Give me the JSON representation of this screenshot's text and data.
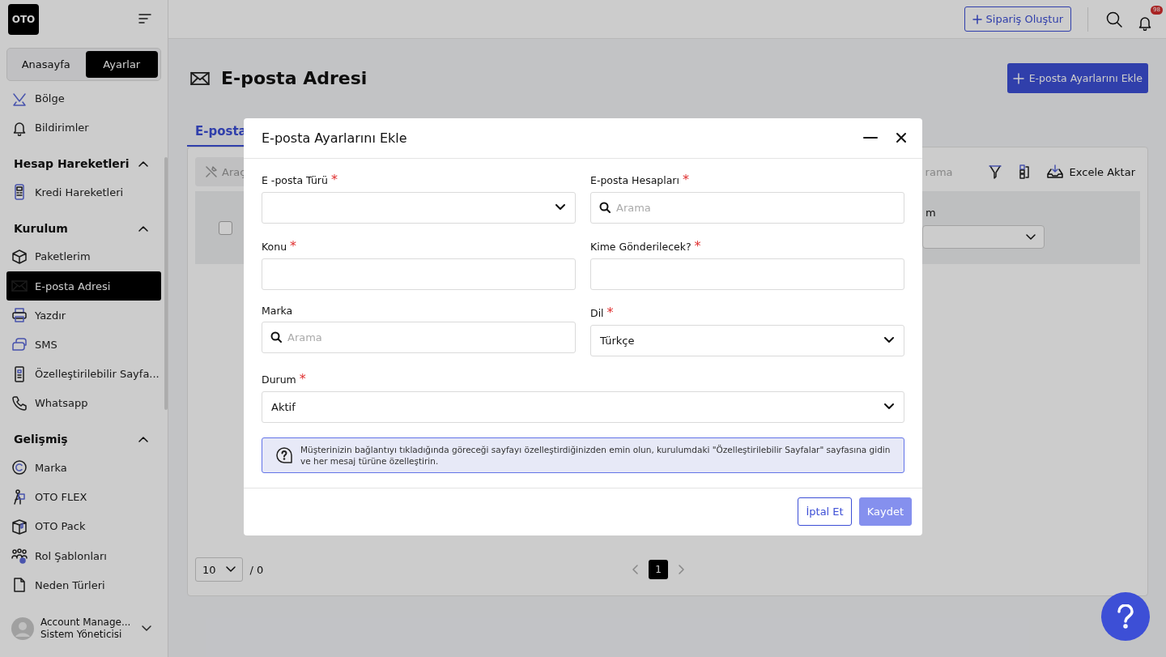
{
  "sidebar": {
    "logo": "OTO",
    "mode_tabs": [
      {
        "label": "Anasayfa",
        "selected": false
      },
      {
        "label": "Ayarlar",
        "selected": true
      }
    ],
    "nav": [
      {
        "kind": "item",
        "label": "Bölge",
        "selected": false
      },
      {
        "kind": "item",
        "label": "Bildirimler",
        "selected": false
      },
      {
        "kind": "section",
        "label": "Hesap Hareketleri",
        "expanded": true,
        "children": [
          {
            "kind": "item",
            "label": "Kredi Hareketleri",
            "selected": false
          }
        ]
      },
      {
        "kind": "section",
        "label": "Kurulum",
        "expanded": true,
        "children": [
          {
            "kind": "item",
            "label": "Paketlerim",
            "selected": false
          },
          {
            "kind": "item",
            "label": "E-posta Adresi",
            "selected": true
          },
          {
            "kind": "item",
            "label": "Yazdır",
            "selected": false
          },
          {
            "kind": "item",
            "label": "SMS",
            "selected": false
          },
          {
            "kind": "item",
            "label": "Özelleştirilebilir Sayfa...",
            "selected": false
          },
          {
            "kind": "item",
            "label": "Whatsapp",
            "selected": false
          }
        ]
      },
      {
        "kind": "section",
        "label": "Gelişmiş",
        "expanded": true,
        "children": [
          {
            "kind": "item",
            "label": "Marka",
            "selected": false
          },
          {
            "kind": "item",
            "label": "OTO FLEX",
            "selected": false
          },
          {
            "kind": "item",
            "label": "OTO Pack",
            "selected": false
          },
          {
            "kind": "item",
            "label": "Rol Şablonları",
            "selected": false
          },
          {
            "kind": "item",
            "label": "Neden Türleri",
            "selected": false
          }
        ]
      }
    ],
    "user": {
      "name": "Account Manage...",
      "role": "Sistem Yöneticisi"
    }
  },
  "topbar": {
    "create_order_button": "Sipariş Oluştur",
    "notification_count": "98"
  },
  "page": {
    "title": "E-posta Adresi",
    "add_button": "E-posta Ayarlarını Ekle",
    "tabs": [
      {
        "label": "E-posta",
        "selected": true
      }
    ],
    "toolbar": {
      "tools_button": "Araç",
      "search_placeholder": "rama",
      "export_button": "Excele Aktar"
    },
    "table": {
      "select_all_checked": false,
      "column_header": "m"
    },
    "pagination": {
      "page_size": "10",
      "total": "/ 0",
      "pages": [
        {
          "label": "1",
          "selected": true
        }
      ]
    }
  },
  "modal": {
    "title": "E-posta Ayarlarını Ekle",
    "fields": [
      {
        "label": "E -posta Türü",
        "required_mark": "*",
        "kind": "select"
      },
      {
        "label": "E-posta Hesapları",
        "required_mark": "*",
        "kind": "search",
        "placeholder": "Arama"
      },
      {
        "label": "Konu",
        "required_mark": "*",
        "kind": "text"
      },
      {
        "label": "Kime Gönderilecek?",
        "required_mark": "*",
        "kind": "text"
      },
      {
        "label": "Marka",
        "kind": "search",
        "placeholder": "Arama"
      },
      {
        "label": "Dil",
        "required_mark": "*",
        "kind": "select",
        "value": "Türkçe"
      },
      {
        "label": "Durum",
        "required_mark": "*",
        "kind": "select",
        "value": "Aktif",
        "wide": true
      }
    ],
    "info": "Müşterinizin bağlantıyı tıkladığında göreceği sayfayı özelleştirdiğinizden emin olun, kurulumdaki \"Özelleştirilebilir Sayfalar\" sayfasına gidin ve her mesaj türüne özelleştirin.",
    "buttons": [
      {
        "label": "İptal Et",
        "kind": "outline",
        "disabled": false
      },
      {
        "label": "Kaydet",
        "kind": "primary",
        "disabled": true
      }
    ]
  }
}
